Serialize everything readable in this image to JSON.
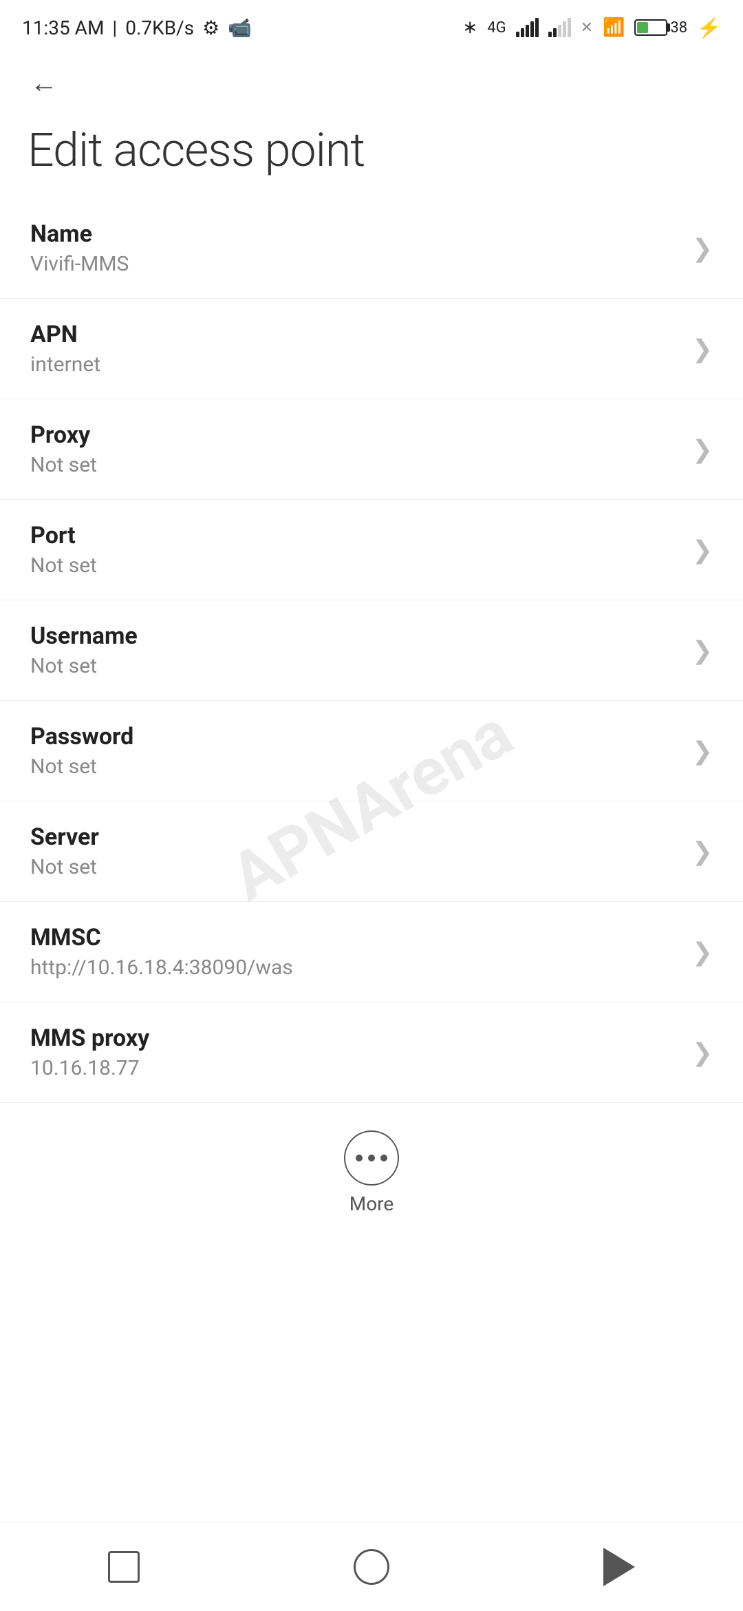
{
  "status_bar": {
    "time": "11:35 AM",
    "speed": "0.7KB/s"
  },
  "toolbar": {
    "back_label": "←"
  },
  "page": {
    "title": "Edit access point"
  },
  "settings_items": [
    {
      "label": "Name",
      "value": "Vivifi-MMS"
    },
    {
      "label": "APN",
      "value": "internet"
    },
    {
      "label": "Proxy",
      "value": "Not set"
    },
    {
      "label": "Port",
      "value": "Not set"
    },
    {
      "label": "Username",
      "value": "Not set"
    },
    {
      "label": "Password",
      "value": "Not set"
    },
    {
      "label": "Server",
      "value": "Not set"
    },
    {
      "label": "MMSC",
      "value": "http://10.16.18.4:38090/was"
    },
    {
      "label": "MMS proxy",
      "value": "10.16.18.77"
    }
  ],
  "more_button": {
    "label": "More"
  },
  "watermark": "APNArena"
}
